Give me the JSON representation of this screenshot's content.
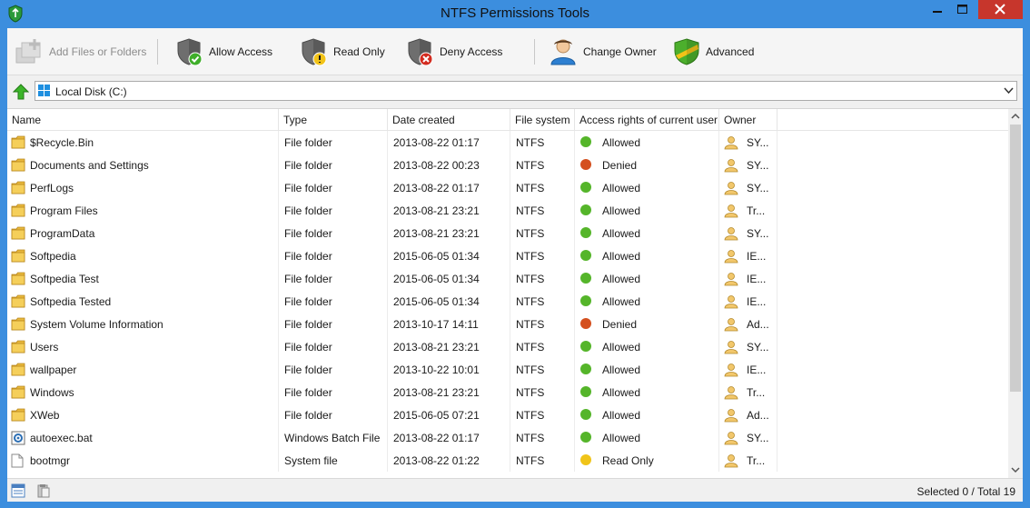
{
  "window": {
    "title": "NTFS Permissions Tools"
  },
  "toolbar": {
    "add_label": "Add Files or Folders",
    "allow_label": "Allow Access",
    "readonly_label": "Read Only",
    "deny_label": "Deny Access",
    "owner_label": "Change Owner",
    "advanced_label": "Advanced"
  },
  "address": {
    "path": "Local Disk (C:)"
  },
  "columns": {
    "name": "Name",
    "type": "Type",
    "date": "Date created",
    "fs": "File system",
    "access": "Access rights of current user",
    "owner": "Owner"
  },
  "status_colors": {
    "Allowed": "#55b52a",
    "Denied": "#d4501f",
    "Read Only": "#f0c419"
  },
  "rows": [
    {
      "name": "$Recycle.Bin",
      "icon": "folder-icon",
      "type": "File folder",
      "date": "2013-08-22 01:17",
      "fs": "NTFS",
      "access": "Allowed",
      "owner": "SY..."
    },
    {
      "name": "Documents and Settings",
      "icon": "folder-icon",
      "type": "File folder",
      "date": "2013-08-22 00:23",
      "fs": "NTFS",
      "access": "Denied",
      "owner": "SY..."
    },
    {
      "name": "PerfLogs",
      "icon": "folder-icon",
      "type": "File folder",
      "date": "2013-08-22 01:17",
      "fs": "NTFS",
      "access": "Allowed",
      "owner": "SY..."
    },
    {
      "name": "Program Files",
      "icon": "folder-icon",
      "type": "File folder",
      "date": "2013-08-21 23:21",
      "fs": "NTFS",
      "access": "Allowed",
      "owner": "Tr..."
    },
    {
      "name": "ProgramData",
      "icon": "folder-icon",
      "type": "File folder",
      "date": "2013-08-21 23:21",
      "fs": "NTFS",
      "access": "Allowed",
      "owner": "SY..."
    },
    {
      "name": "Softpedia",
      "icon": "folder-icon",
      "type": "File folder",
      "date": "2015-06-05 01:34",
      "fs": "NTFS",
      "access": "Allowed",
      "owner": "IE..."
    },
    {
      "name": "Softpedia Test",
      "icon": "folder-icon",
      "type": "File folder",
      "date": "2015-06-05 01:34",
      "fs": "NTFS",
      "access": "Allowed",
      "owner": "IE..."
    },
    {
      "name": "Softpedia Tested",
      "icon": "folder-icon",
      "type": "File folder",
      "date": "2015-06-05 01:34",
      "fs": "NTFS",
      "access": "Allowed",
      "owner": "IE..."
    },
    {
      "name": "System Volume Information",
      "icon": "folder-icon",
      "type": "File folder",
      "date": "2013-10-17 14:11",
      "fs": "NTFS",
      "access": "Denied",
      "owner": "Ad..."
    },
    {
      "name": "Users",
      "icon": "folder-icon",
      "type": "File folder",
      "date": "2013-08-21 23:21",
      "fs": "NTFS",
      "access": "Allowed",
      "owner": "SY..."
    },
    {
      "name": "wallpaper",
      "icon": "folder-icon",
      "type": "File folder",
      "date": "2013-10-22 10:01",
      "fs": "NTFS",
      "access": "Allowed",
      "owner": "IE..."
    },
    {
      "name": "Windows",
      "icon": "folder-icon",
      "type": "File folder",
      "date": "2013-08-21 23:21",
      "fs": "NTFS",
      "access": "Allowed",
      "owner": "Tr..."
    },
    {
      "name": "XWeb",
      "icon": "folder-icon",
      "type": "File folder",
      "date": "2015-06-05 07:21",
      "fs": "NTFS",
      "access": "Allowed",
      "owner": "Ad..."
    },
    {
      "name": "autoexec.bat",
      "icon": "batch-file-icon",
      "type": "Windows Batch File",
      "date": "2013-08-22 01:17",
      "fs": "NTFS",
      "access": "Allowed",
      "owner": "SY..."
    },
    {
      "name": "bootmgr",
      "icon": "file-icon",
      "type": "System file",
      "date": "2013-08-22 01:22",
      "fs": "NTFS",
      "access": "Read Only",
      "owner": "Tr..."
    }
  ],
  "status": {
    "text": "Selected 0 / Total 19"
  }
}
